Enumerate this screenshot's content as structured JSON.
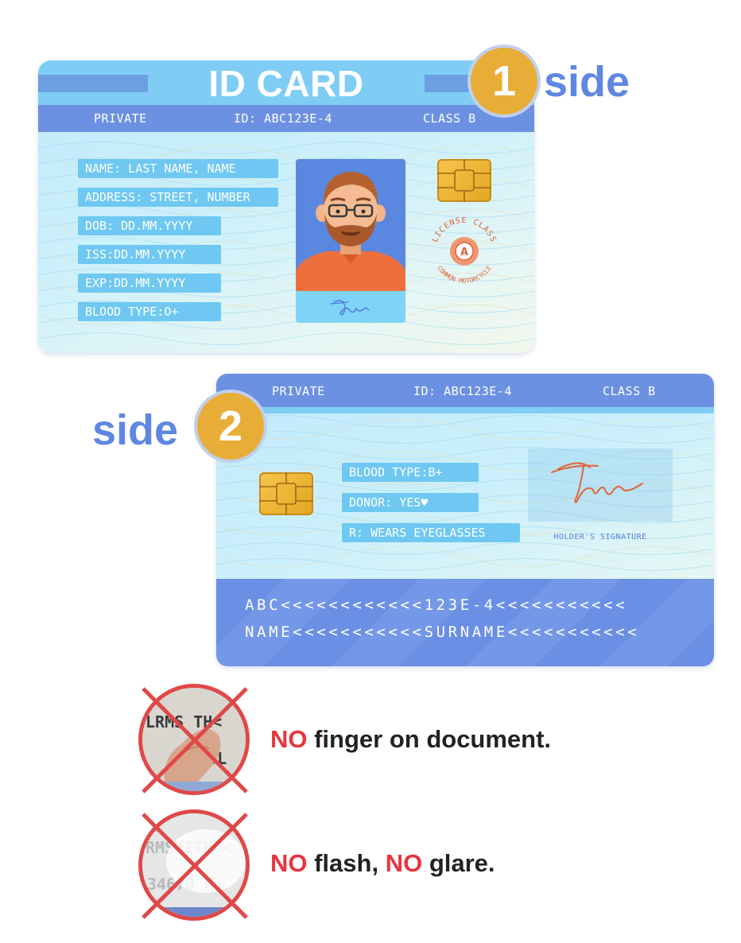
{
  "side1": {
    "badge_number": "1",
    "badge_word": "side"
  },
  "side2": {
    "badge_number": "2",
    "badge_word": "side"
  },
  "card_front": {
    "title": "ID CARD",
    "header": {
      "left": "PRIVATE",
      "center": "ID: ABC123E-4",
      "right": "CLASS B"
    },
    "fields": [
      "NAME: LAST NAME, NAME",
      "ADDRESS: STREET, NUMBER",
      "DOB: DD.MM.YYYY",
      "ISS:DD.MM.YYYY",
      "EXP:DD.MM.YYYY",
      "BLOOD TYPE:O+"
    ],
    "stamp": {
      "top_text": "LICENSE CLASS",
      "letter": "A",
      "bottom_text": "COMMON MOTORCYCLE"
    }
  },
  "card_back": {
    "header": {
      "left": "PRIVATE",
      "center": "ID: ABC123E-4",
      "right": "CLASS B"
    },
    "fields": [
      "BLOOD TYPE:B+",
      "DONOR: YES♥",
      "R: WEARS EYEGLASSES"
    ],
    "signature_caption": "HOLDER'S SIGNATURE",
    "mrz": [
      "ABC<<<<<<<<<<<<123E-4<<<<<<<<<<<",
      "NAME<<<<<<<<<<<SURNAME<<<<<<<<<<<"
    ]
  },
  "warnings": [
    {
      "no_word": "NO",
      "rest": " finger on document.",
      "thumb_text_top": "LRMS  TH<",
      "thumb_text_bottom": "70L"
    },
    {
      "no_word_1": "NO",
      "middle": " flash, ",
      "no_word_2": "NO",
      "rest": " glare.",
      "thumb_text_top": "RMSMITH<<",
      "thumb_text_bottom": "34670 R"
    }
  ],
  "colors": {
    "accent_blue": "#6c91e2",
    "light_blue": "#7fcdf4",
    "badge_orange": "#e8ad37",
    "warning_red": "#e8353e"
  }
}
